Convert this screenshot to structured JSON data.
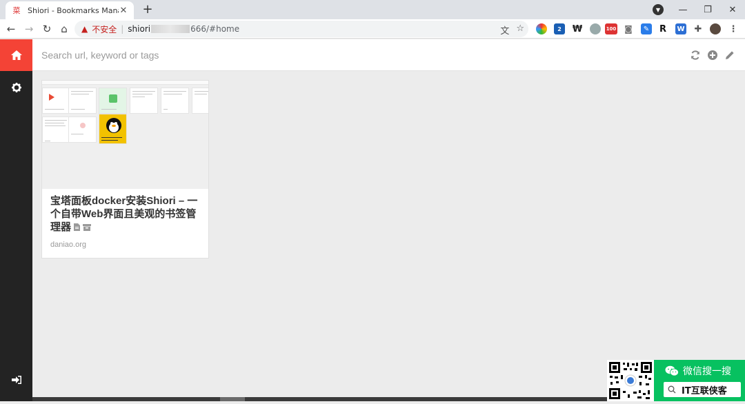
{
  "browser": {
    "tab_title": "Shiori - Bookmarks Manager",
    "tab_favicon": "菜",
    "new_tab": "+",
    "insecure_label": "不安全",
    "url_host": "shiori",
    "url_rest": "666/#home",
    "ext_badge_1": "2",
    "ext_badge_2": "100",
    "ext_r": "R"
  },
  "app": {
    "search_placeholder": "Search url, keyword or tags",
    "accent_color": "#f44336",
    "sidebar_color": "#232323"
  },
  "bookmark": {
    "title": "宝塔面板docker安装Shiori – 一个自带Web界面且美观的书签管理器",
    "domain": "daniao.org"
  },
  "overlay": {
    "wechat_label": "微信搜一搜",
    "account_name": "IT互联侠客"
  }
}
